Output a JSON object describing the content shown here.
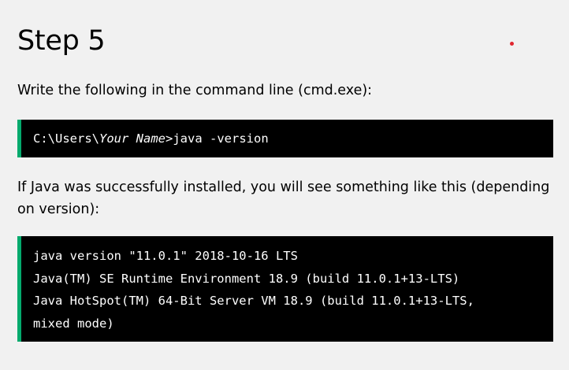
{
  "heading": "Step 5",
  "instruction": "Write the following in the command line (cmd.exe):",
  "command": {
    "prefix": "C:\\Users\\",
    "placeholder": "Your Name",
    "suffix": ">java -version"
  },
  "result_text": "If Java was successfully installed, you will see something like this (depending on version):",
  "output_lines": [
    "java version \"11.0.1\" 2018-10-16 LTS",
    "Java(TM) SE Runtime Environment 18.9 (build 11.0.1+13-LTS)",
    "Java HotSpot(TM) 64-Bit Server VM 18.9 (build 11.0.1+13-LTS,",
    "mixed mode)"
  ],
  "colors": {
    "background": "#f1f1f1",
    "code_background": "#000000",
    "code_accent": "#04aa6d",
    "dot": "#e0262f"
  }
}
